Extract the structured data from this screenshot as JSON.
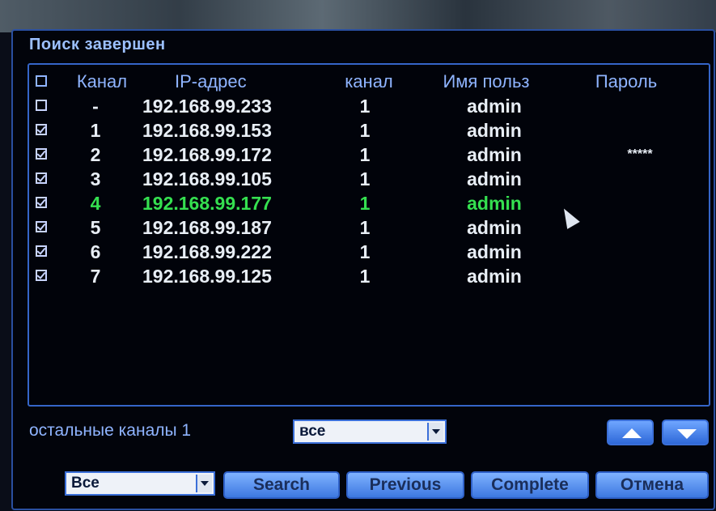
{
  "dialog": {
    "title": "Поиск завершен"
  },
  "table": {
    "headers": {
      "channel": "Канал",
      "ip": "IP-адрес",
      "channel_num": "канал",
      "user": "Имя польз",
      "password": "Пароль"
    },
    "rows": [
      {
        "checked": false,
        "channel": "-",
        "ip": "192.168.99.233",
        "channel_num": "1",
        "user": "admin",
        "password": ""
      },
      {
        "checked": true,
        "channel": "1",
        "ip": "192.168.99.153",
        "channel_num": "1",
        "user": "admin",
        "password": ""
      },
      {
        "checked": true,
        "channel": "2",
        "ip": "192.168.99.172",
        "channel_num": "1",
        "user": "admin",
        "password": "*****"
      },
      {
        "checked": true,
        "channel": "3",
        "ip": "192.168.99.105",
        "channel_num": "1",
        "user": "admin",
        "password": ""
      },
      {
        "checked": true,
        "channel": "4",
        "ip": "192.168.99.177",
        "channel_num": "1",
        "user": "admin",
        "password": "",
        "selected": true
      },
      {
        "checked": true,
        "channel": "5",
        "ip": "192.168.99.187",
        "channel_num": "1",
        "user": "admin",
        "password": ""
      },
      {
        "checked": true,
        "channel": "6",
        "ip": "192.168.99.222",
        "channel_num": "1",
        "user": "admin",
        "password": ""
      },
      {
        "checked": true,
        "channel": "7",
        "ip": "192.168.99.125",
        "channel_num": "1",
        "user": "admin",
        "password": ""
      }
    ]
  },
  "footer": {
    "remaining_label": "остальные каналы 1",
    "channels_select": "все",
    "filter_select": "Все",
    "search_label": "Search",
    "previous_label": "Previous",
    "complete_label": "Complete",
    "cancel_label": "Отмена"
  },
  "colors": {
    "accent": "#3b6fd8",
    "selected_row": "#35e050",
    "header_text": "#8fb4ff"
  },
  "icons": {
    "scroll_up": "up-arrow-icon",
    "scroll_down": "down-arrow-icon",
    "pointer": "mouse-cursor-icon"
  }
}
